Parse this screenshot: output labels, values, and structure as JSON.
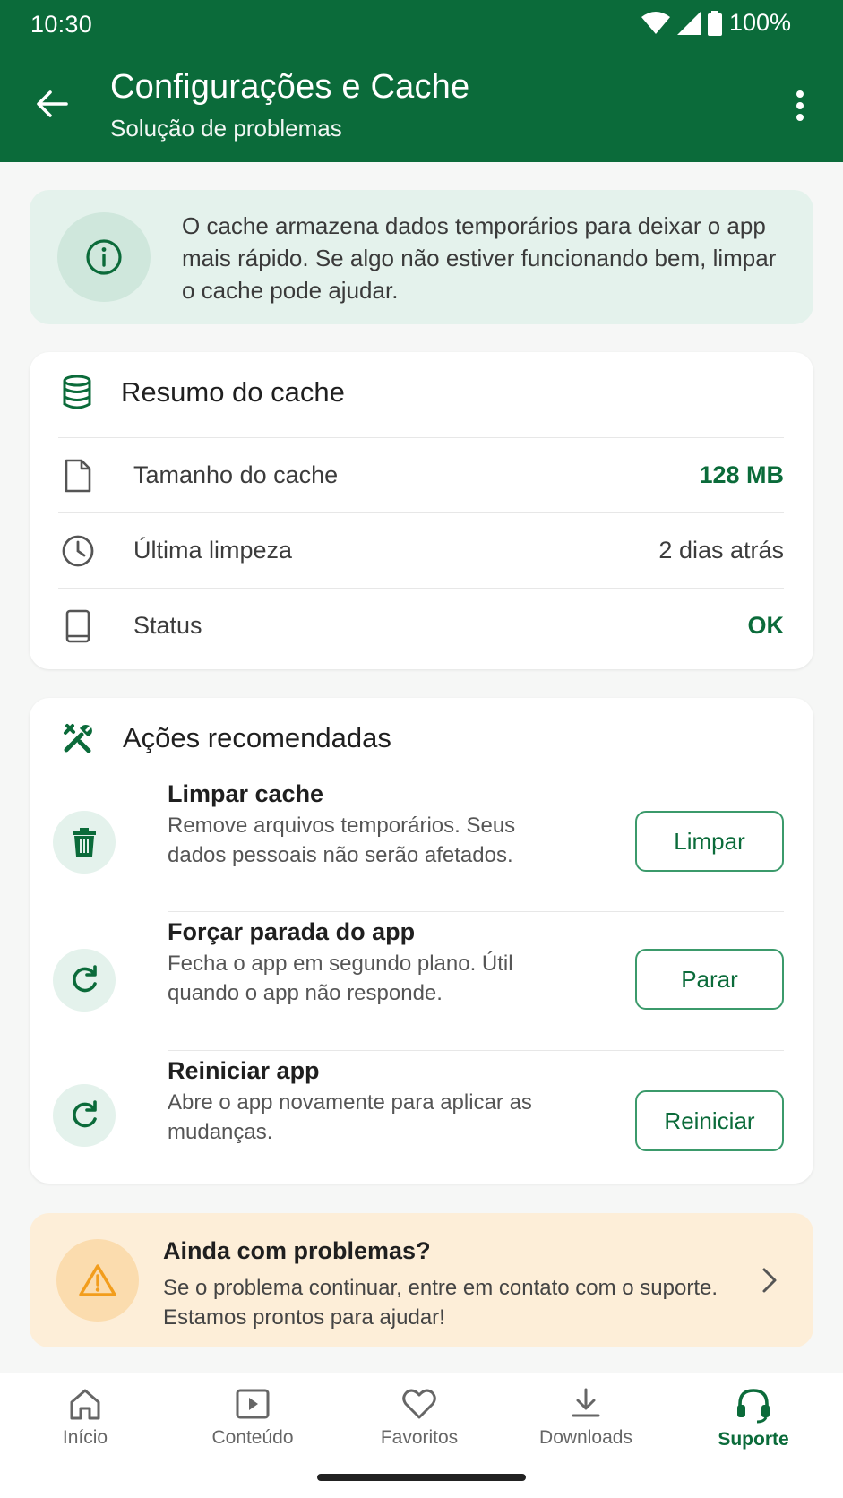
{
  "status_bar": {
    "time": "10:30",
    "battery": "100%"
  },
  "app_bar": {
    "title": "Configurações e Cache",
    "subtitle": "Solução de problemas"
  },
  "info_banner": {
    "text": "O cache armazena dados temporários para deixar o app mais rápido. Se algo não estiver funcionando bem, limpar o cache pode ajudar."
  },
  "cache_summary": {
    "title": "Resumo do cache",
    "rows": [
      {
        "label": "Tamanho do cache",
        "value": "128 MB",
        "icon": "file-icon"
      },
      {
        "label": "Última limpeza",
        "value": "2 dias atrás",
        "icon": "clock-icon"
      },
      {
        "label": "Status",
        "value": "OK",
        "icon": "phone-icon"
      }
    ]
  },
  "actions": {
    "title": "Ações recomendadas",
    "items": [
      {
        "title": "Limpar cache",
        "description": "Remove arquivos temporários. Seus dados pessoais não serão afetados.",
        "button": "Limpar",
        "icon": "trash-icon"
      },
      {
        "title": "Forçar parada do app",
        "description": "Fecha o app em segundo plano. Útil quando o app não responde.",
        "button": "Parar",
        "icon": "refresh-icon"
      },
      {
        "title": "Reiniciar app",
        "description": "Abre o app novamente para aplicar as mudanças.",
        "button": "Reiniciar",
        "icon": "refresh-icon"
      }
    ]
  },
  "warning_banner": {
    "title": "Ainda com problemas?",
    "text": "Se o problema continuar, entre em contato com o suporte. Estamos prontos para ajudar!"
  },
  "bottom_nav": {
    "items": [
      {
        "label": "Início",
        "icon": "home-icon"
      },
      {
        "label": "Conteúdo",
        "icon": "play-icon"
      },
      {
        "label": "Favoritos",
        "icon": "heart-icon"
      },
      {
        "label": "Downloads",
        "icon": "download-icon"
      },
      {
        "label": "Suporte",
        "icon": "headset-icon",
        "active": true
      }
    ]
  },
  "colors": {
    "primary": "#0b6b3a",
    "info_bg": "#e4f2ec",
    "warning_bg": "#fdeed8",
    "warning_icon": "#f29d1c"
  }
}
